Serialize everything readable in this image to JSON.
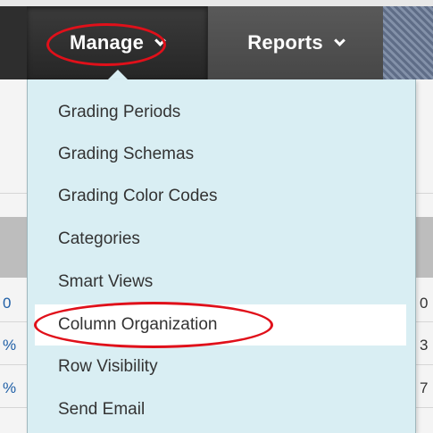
{
  "toolbar": {
    "tabs": [
      {
        "label": "Manage",
        "icon": "chevron-down-icon"
      },
      {
        "label": "Reports",
        "icon": "chevron-down-icon"
      }
    ]
  },
  "menu": {
    "items": [
      {
        "label": "Grading Periods"
      },
      {
        "label": "Grading Schemas"
      },
      {
        "label": "Grading Color Codes"
      },
      {
        "label": "Categories"
      },
      {
        "label": "Smart Views"
      },
      {
        "label": "Column Organization",
        "highlighted": true
      },
      {
        "label": "Row Visibility"
      },
      {
        "label": "Send Email"
      }
    ]
  },
  "grid": {
    "left_fragments": [
      "0",
      "%",
      "%"
    ],
    "right_fragments": [
      "0",
      "3",
      "7"
    ]
  },
  "colors": {
    "toolbar": "#3f3f3f",
    "menu_background": "#d9eef3",
    "menu_highlight": "#ffffff",
    "annotation": "#e0101a"
  }
}
